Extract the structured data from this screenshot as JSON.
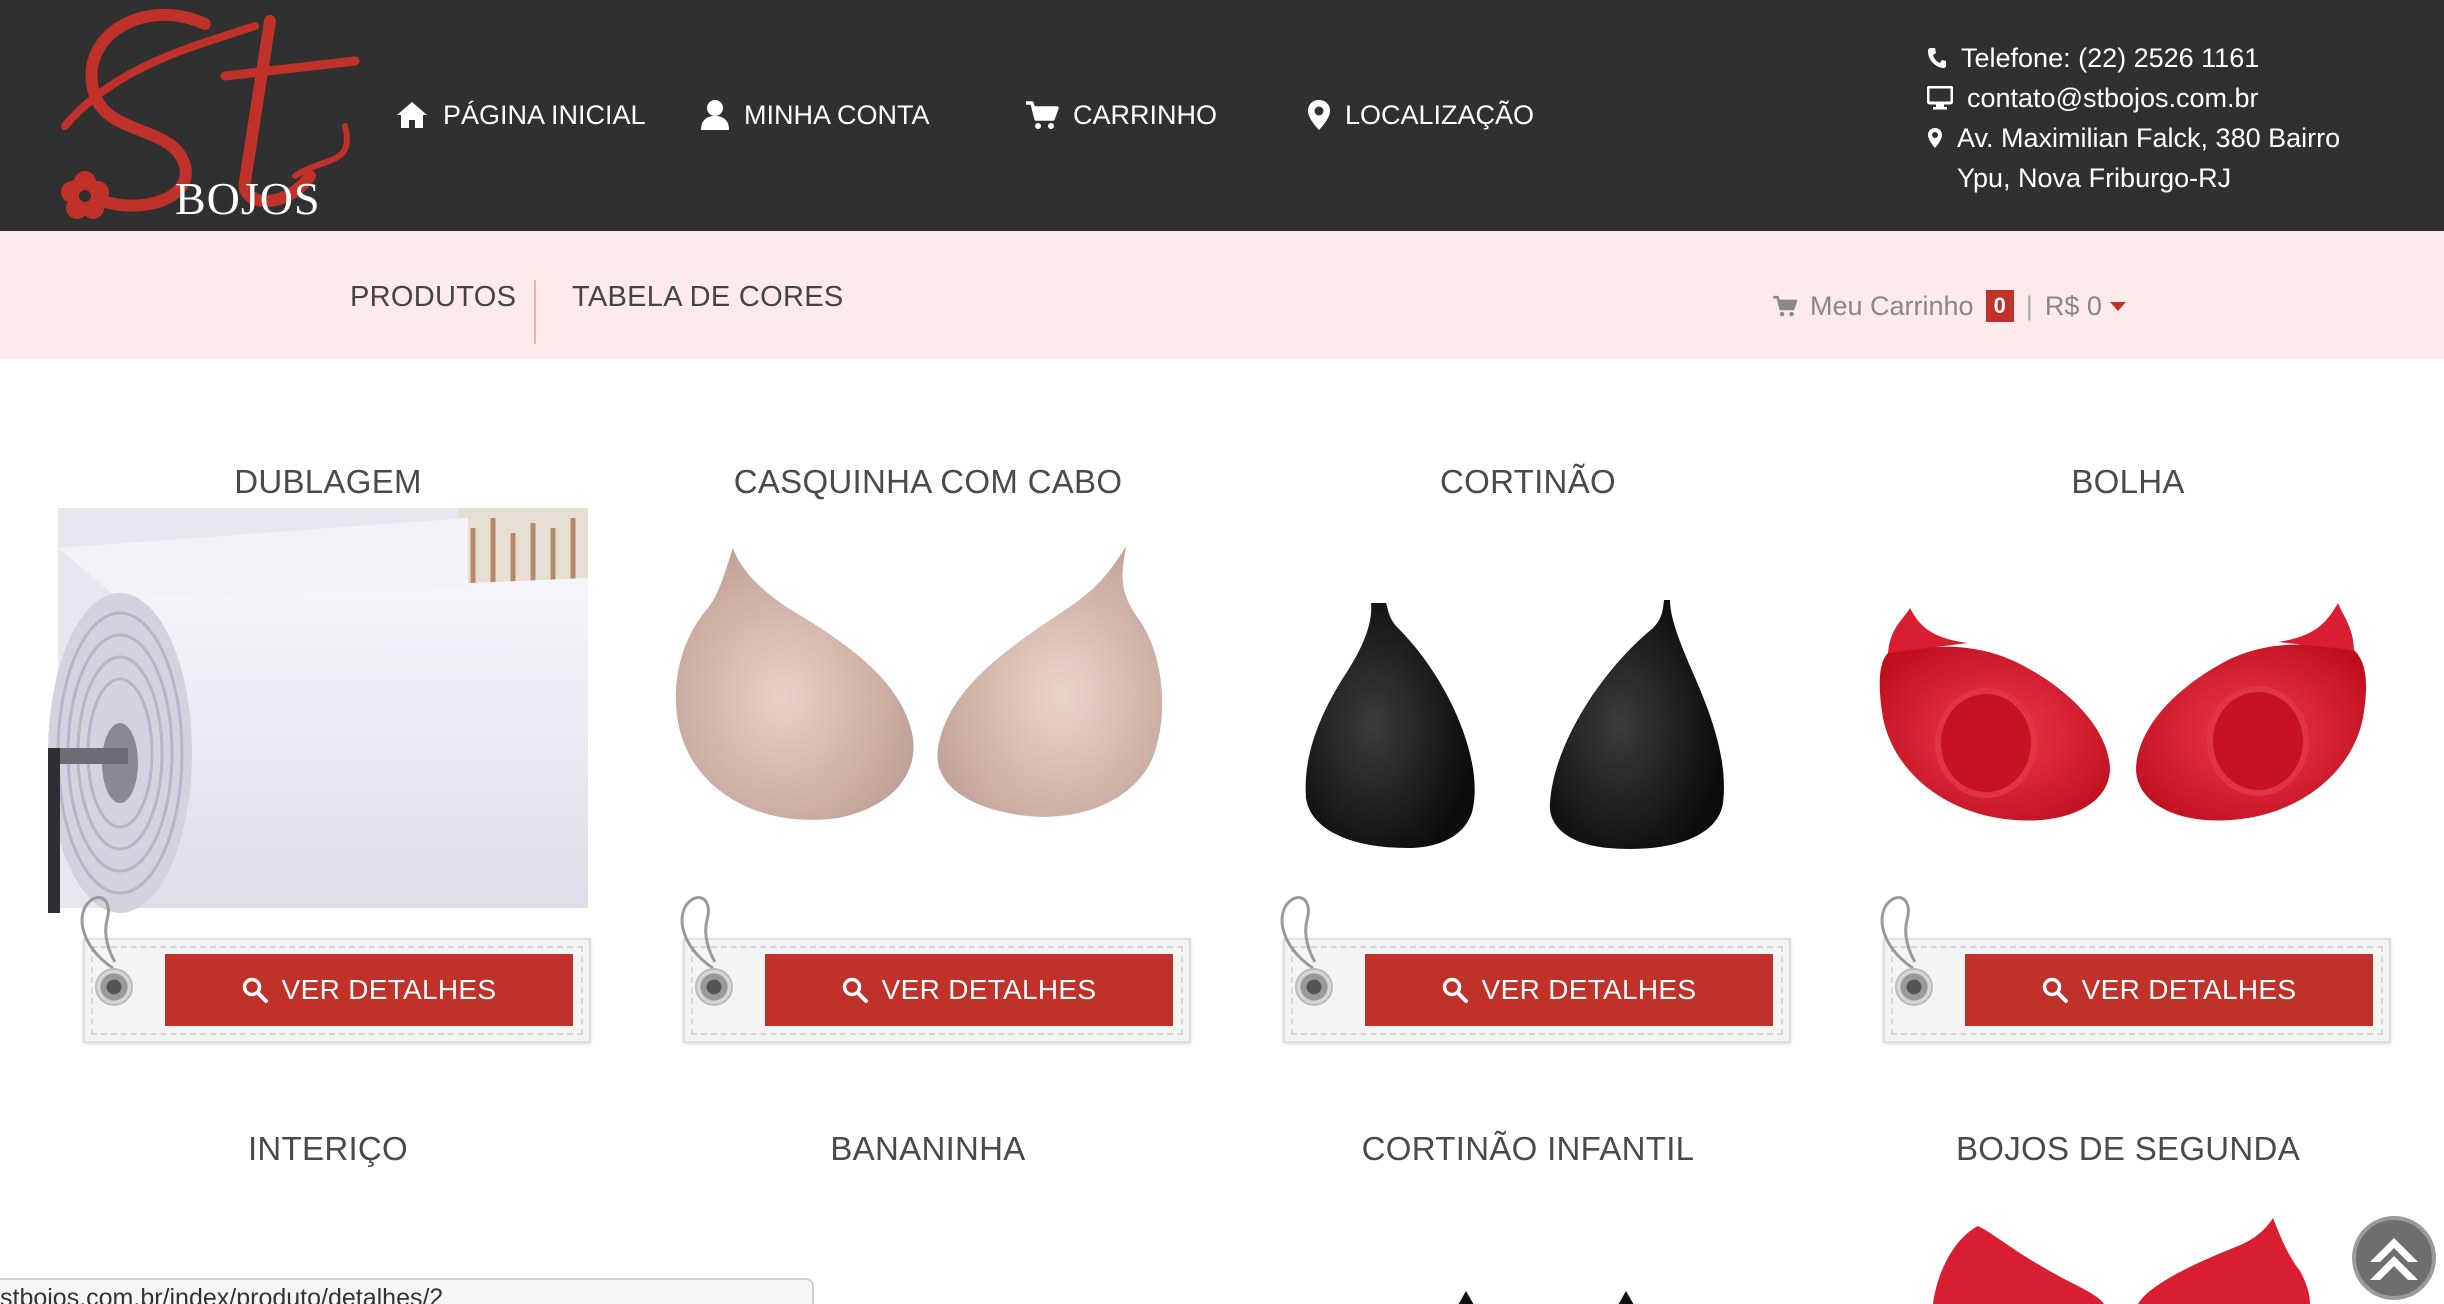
{
  "header": {
    "logo_text": "BOJOS",
    "logo_monogram": "St",
    "nav": [
      {
        "label": "PÁGINA INICIAL",
        "icon": "home-icon"
      },
      {
        "label": "MINHA CONTA",
        "icon": "user-icon"
      },
      {
        "label": "CARRINHO",
        "icon": "cart-icon"
      },
      {
        "label": "LOCALIZAÇÃO",
        "icon": "map-marker-icon"
      }
    ],
    "contact": {
      "phone": "Telefone: (22) 2526 1161",
      "email": "contato@stbojos.com.br",
      "address": "Av. Maximilian Falck, 380 Bairro Ypu, Nova Friburgo-RJ"
    }
  },
  "subnav": {
    "links": [
      "PRODUTOS",
      "TABELA DE CORES"
    ],
    "cart_label": "Meu Carrinho",
    "cart_count": "0",
    "cart_separator": "|",
    "cart_total": "R$ 0"
  },
  "products": [
    {
      "title": "DUBLAGEM",
      "button": "VER DETALHES"
    },
    {
      "title": "CASQUINHA COM CABO",
      "button": "VER DETALHES"
    },
    {
      "title": "CORTINÃO",
      "button": "VER DETALHES"
    },
    {
      "title": "BOLHA",
      "button": "VER DETALHES"
    },
    {
      "title": "INTERIÇO"
    },
    {
      "title": "BANANINHA"
    },
    {
      "title": "CORTINÃO INFANTIL"
    },
    {
      "title": "BOJOS DE SEGUNDA"
    }
  ],
  "status_bar": {
    "url": "stbojos.com.br/index/produto/detalhes/2"
  },
  "colors": {
    "header_bg": "#303030",
    "subbar_bg": "#fdeaea",
    "accent_red": "#c0312a"
  }
}
